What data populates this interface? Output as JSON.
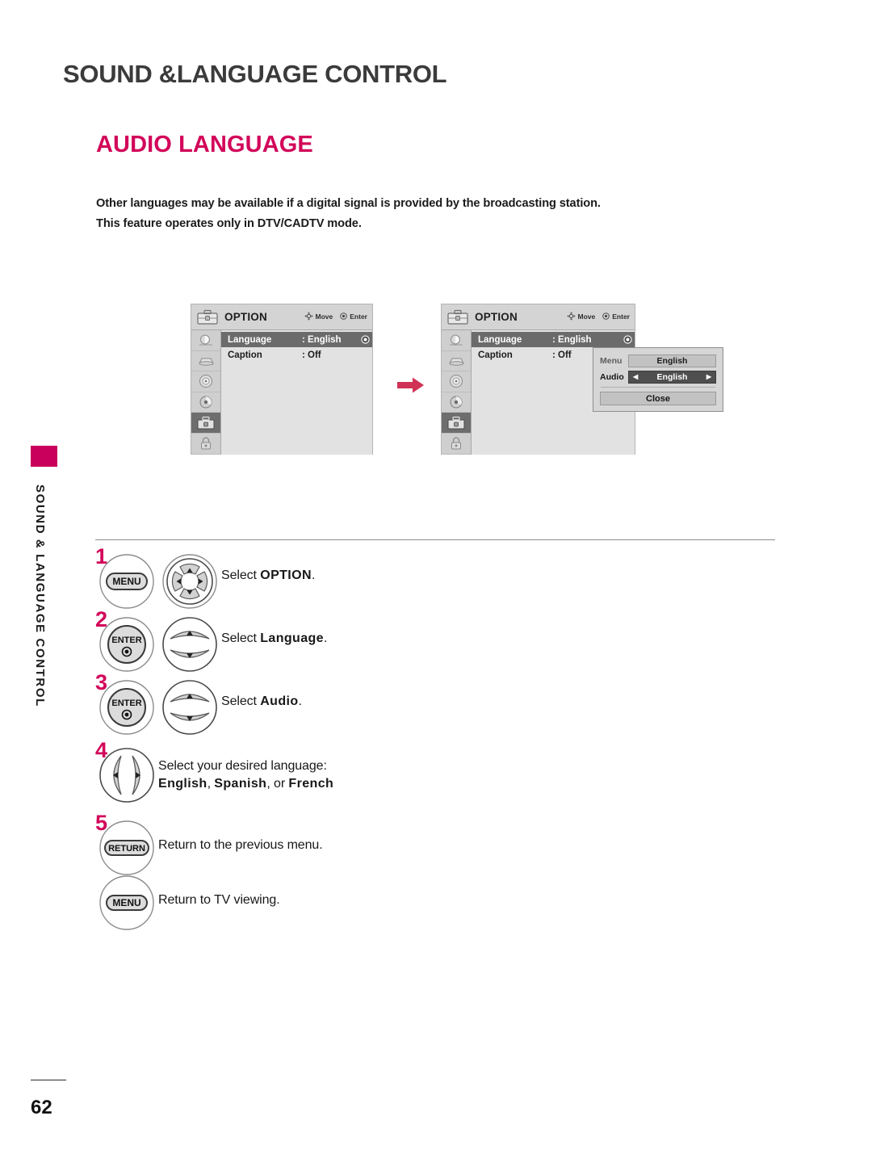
{
  "chapter": {
    "title": "SOUND &LANGUAGE CONTROL"
  },
  "section": {
    "title": "AUDIO LANGUAGE"
  },
  "intro": {
    "line1": "Other languages may be available if a digital signal is provided by the broadcasting station.",
    "line2": "This feature operates only in DTV/CADTV mode."
  },
  "side_tab": {
    "label": "SOUND & LANGUAGE CONTROL"
  },
  "osd": {
    "title": "OPTION",
    "hints": {
      "move": "Move",
      "enter": "Enter"
    },
    "rows": [
      {
        "label": "Language",
        "value": ": English",
        "selected": true,
        "marker": "enter-dot-icon"
      },
      {
        "label": "Caption",
        "value": ": Off",
        "selected": false,
        "marker": ""
      }
    ],
    "rail_icons": [
      "picture-icon",
      "audio-icon",
      "time-icon",
      "setup-icon",
      "option-icon",
      "lock-icon"
    ],
    "head_icon": "option-briefcase-icon"
  },
  "popup": {
    "menu_label": "Menu",
    "menu_value": "English",
    "audio_label": "Audio",
    "audio_value": "English",
    "close_label": "Close"
  },
  "steps": [
    {
      "num": "1",
      "button": "MENU",
      "pad": "four-way",
      "text_pre": "Select ",
      "text_bold": "OPTION",
      "text_post": "."
    },
    {
      "num": "2",
      "button": "ENTER",
      "pad": "up-down",
      "text_pre": "Select ",
      "text_bold": "Language",
      "text_post": "."
    },
    {
      "num": "3",
      "button": "ENTER",
      "pad": "up-down",
      "text_pre": "Select ",
      "text_bold": "Audio",
      "text_post": "."
    },
    {
      "num": "4",
      "button": "",
      "pad": "left-right",
      "text_line1": "Select  your  desired  language:",
      "opt1": "English",
      "sep1": ", ",
      "opt2": "Spanish",
      "sep2": ", or ",
      "opt3": "French"
    },
    {
      "num": "5",
      "button": "RETURN",
      "pad": "",
      "text_pre": "Return to the previous menu.",
      "text_bold": "",
      "text_post": ""
    },
    {
      "num": "",
      "button": "MENU",
      "pad": "",
      "text_pre": "Return to TV viewing.",
      "text_bold": "",
      "text_post": ""
    }
  ],
  "footer": {
    "page_number": "62"
  },
  "colors": {
    "accent": "#d2055a",
    "tab_block": "#c9005c",
    "arrow": "#cf3255",
    "heading_gray": "#3b3b3b"
  }
}
